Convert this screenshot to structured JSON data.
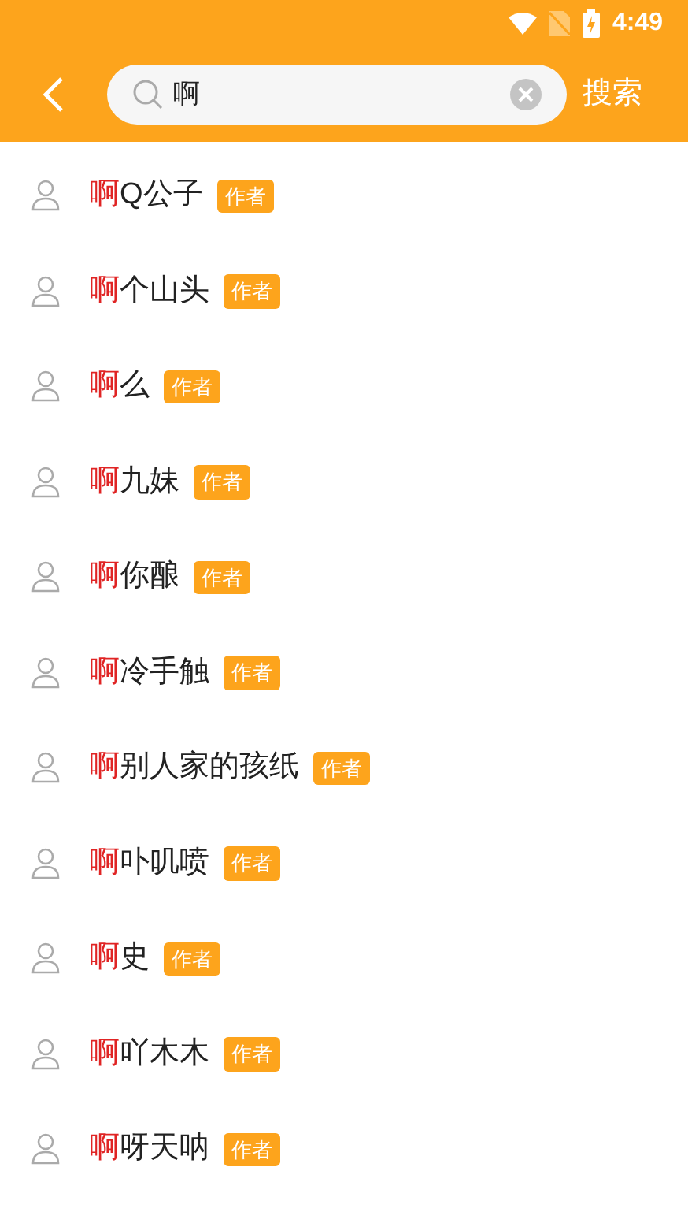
{
  "status_bar": {
    "time": "4:49"
  },
  "search": {
    "value": "啊",
    "submit": "搜索"
  },
  "results": [
    {
      "highlight": "啊",
      "rest": "Q公子",
      "tag": "作者"
    },
    {
      "highlight": "啊",
      "rest": "个山头",
      "tag": "作者"
    },
    {
      "highlight": "啊",
      "rest": "么",
      "tag": "作者"
    },
    {
      "highlight": "啊",
      "rest": "九妹",
      "tag": "作者"
    },
    {
      "highlight": "啊",
      "rest": "你酿",
      "tag": "作者"
    },
    {
      "highlight": "啊",
      "rest": "冷手触",
      "tag": "作者"
    },
    {
      "highlight": "啊",
      "rest": "别人家的孩纸",
      "tag": "作者"
    },
    {
      "highlight": "啊",
      "rest": "卟叽喷",
      "tag": "作者"
    },
    {
      "highlight": "啊",
      "rest": "史",
      "tag": "作者"
    },
    {
      "highlight": "啊",
      "rest": "吖木木",
      "tag": "作者"
    },
    {
      "highlight": "啊",
      "rest": "呀天呐",
      "tag": "作者"
    }
  ]
}
